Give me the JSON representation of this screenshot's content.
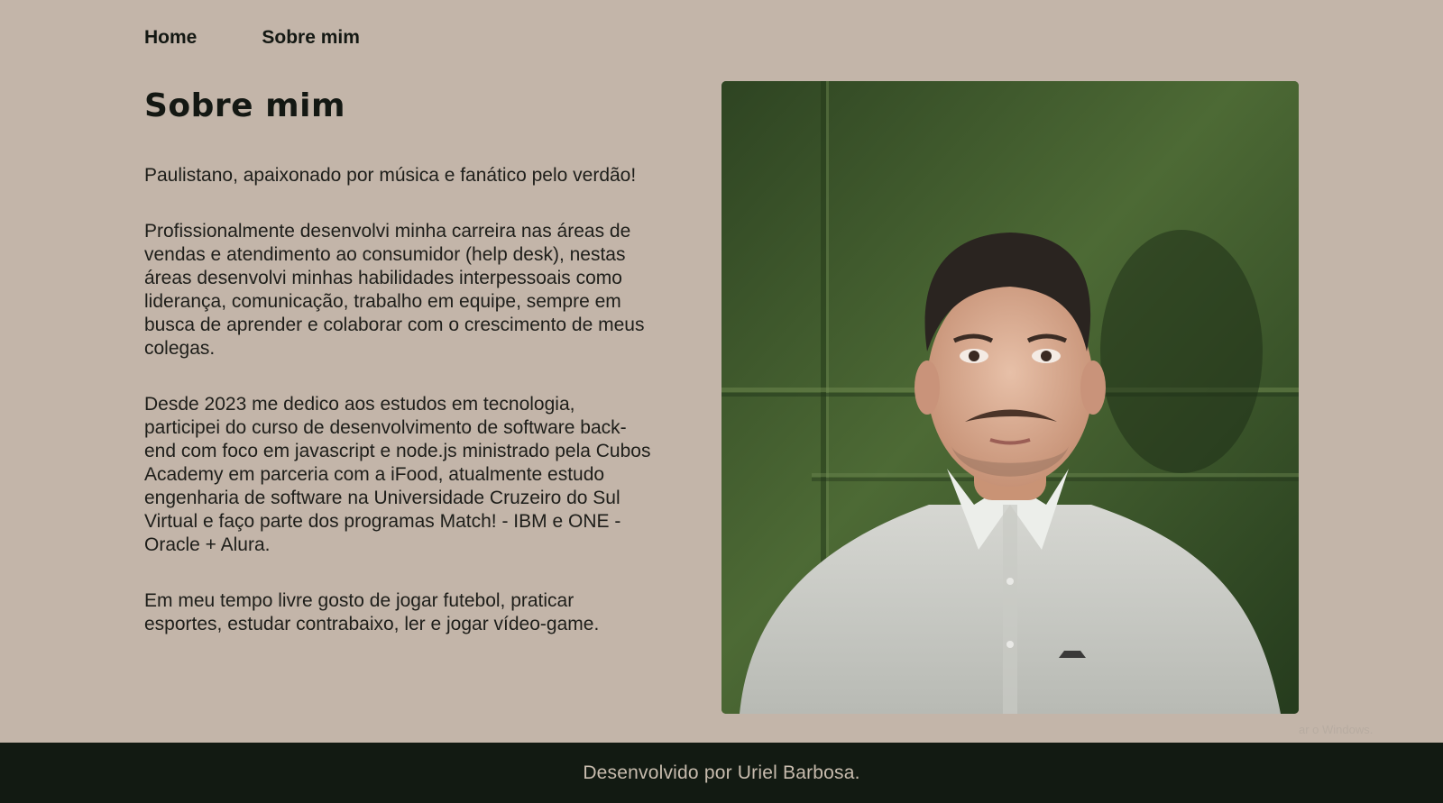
{
  "nav": {
    "items": [
      {
        "label": "Home"
      },
      {
        "label": "Sobre mim"
      }
    ]
  },
  "main": {
    "title": "Sobre mim",
    "paragraphs": [
      "Paulistano, apaixonado por música e fanático pelo verdão!",
      "Profissionalmente desenvolvi minha carreira nas áreas de vendas e atendimento ao consumidor (help desk), nestas áreas desenvolvi minhas habilidades interpessoais como liderança, comunicação, trabalho em equipe, sempre em busca de aprender e colaborar com o crescimento de meus colegas.",
      "Desde 2023 me dedico aos estudos em tecnologia, participei do curso de desenvolvimento de software back-end com foco em javascript e node.js ministrado pela Cubos Academy em parceria com a iFood, atualmente estudo engenharia de software na Universidade Cruzeiro do Sul Virtual e faço parte dos programas Match! - IBM e ONE - Oracle + Alura.",
      "Em meu tempo livre gosto de jogar futebol, praticar esportes, estudar contrabaixo, ler e jogar vídeo-game."
    ]
  },
  "watermark": "ar o Windows.",
  "footer": {
    "text": "Desenvolvido por Uriel Barbosa."
  },
  "colors": {
    "background": "#c3b5a9",
    "footer_bg": "#121a12",
    "footer_text": "#c8bcae",
    "photo_wall": "#3f5a2d"
  }
}
